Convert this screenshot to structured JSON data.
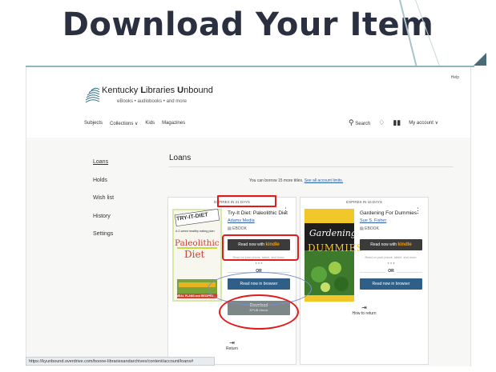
{
  "slide": {
    "title": "Download Your Item"
  },
  "site": {
    "help": "Help",
    "brand_prefix": "Kentucky ",
    "brand_L": "L",
    "brand_mid": "ibraries ",
    "brand_U": "U",
    "brand_suffix": "nbound",
    "tagline": "eBooks • audiobooks • and more",
    "nav": [
      "Subjects",
      "Collections ∨",
      "Kids",
      "Magazines"
    ],
    "nav_right": {
      "search": "Search",
      "account": "My account ∨"
    },
    "sidebar": [
      "Loans",
      "Holds",
      "Wish list",
      "History",
      "Settings"
    ],
    "loans_title": "Loans",
    "borrow_note": "You can borrow 15 more titles.",
    "borrow_link": "See all account limits."
  },
  "cards": [
    {
      "expires": "EXPIRES IN 21 DAYS",
      "title": "Try-It Diet: Paleolithic Diet",
      "author": "Adams Media",
      "format": "EBOOK",
      "kindle_prefix": "Read now with",
      "kindle_word": "kindle",
      "read_note": "Read on your phone, tablet, and more.",
      "or": "OR",
      "browser": "Read now in browser",
      "download": "Download",
      "download_sub": "EPUB ebook",
      "return": "Return",
      "cover": {
        "top": "TRY-IT-DIET",
        "subtitle": "A 2-week healthy eating plan",
        "word1": "Paleolithic",
        "word2": "Diet",
        "footer": "MEAL PLANS and RECIPES"
      }
    },
    {
      "expires": "EXPIRES IN 16 DAYS",
      "title": "Gardening For Dummies",
      "author": "Sue S. Fisher",
      "format": "EBOOK",
      "kindle_prefix": "Read now with",
      "kindle_word": "kindle",
      "read_note": "Read on your phone, tablet, and more.",
      "or": "OR",
      "browser": "Read now in browser",
      "return": "How to return",
      "cover": {
        "word1": "Gardening",
        "word2": "DUMMIES"
      }
    }
  ],
  "status_bar": "https://kyunbound.overdrive.com/boone-librariesandarchives/content/account/loans#",
  "colors": {
    "title": "#2b3040",
    "annotation": "#e11b1b",
    "button_blue": "#2f5f87",
    "button_dark": "#3b3b3b",
    "kindle_orange": "#f39c12"
  }
}
